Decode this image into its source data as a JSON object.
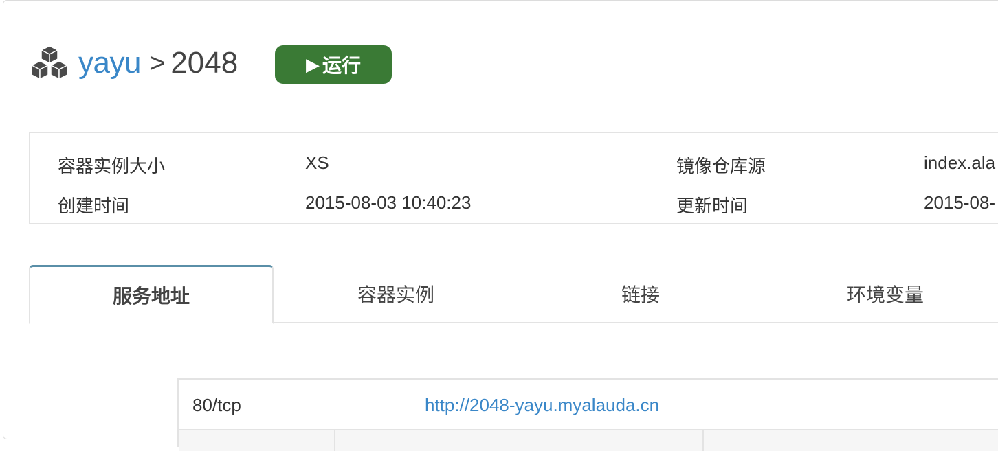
{
  "header": {
    "icon": "cubes-icon",
    "namespace": "yayu",
    "separator": ">",
    "service_name": "2048",
    "status_label": "运行",
    "status_icon": "play-icon",
    "status_color": "#3a7a35"
  },
  "info": {
    "rows": [
      {
        "label1": "容器实例大小",
        "value1": "XS",
        "label2": "镜像仓库源",
        "value2": "index.ala"
      },
      {
        "label1": "创建时间",
        "value1": "2015-08-03 10:40:23",
        "label2": "更新时间",
        "value2": "2015-08-"
      }
    ]
  },
  "tabs": [
    {
      "label": "服务地址",
      "active": true
    },
    {
      "label": "容器实例",
      "active": false
    },
    {
      "label": "链接",
      "active": false
    },
    {
      "label": "环境变量",
      "active": false
    }
  ],
  "endpoints": [
    {
      "port": "80/tcp",
      "url": "http://2048-yayu.myalauda.cn"
    }
  ],
  "colors": {
    "link": "#3a87c8",
    "tab_accent": "#5a8fa8",
    "border": "#e3e3e3"
  }
}
